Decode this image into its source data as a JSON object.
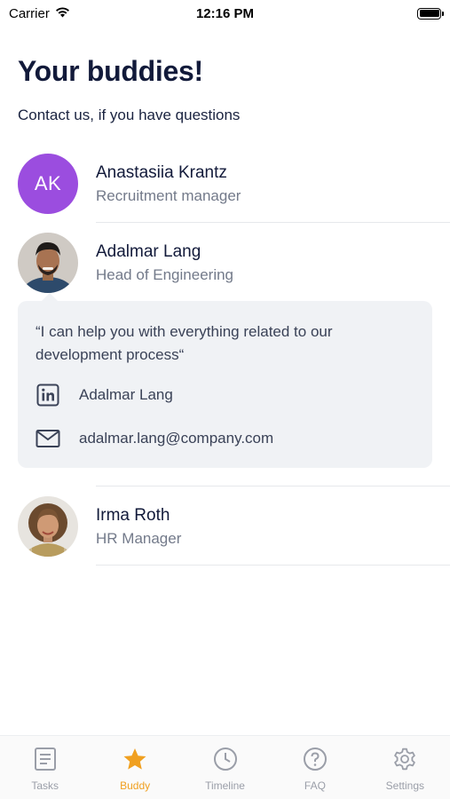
{
  "status_bar": {
    "carrier": "Carrier",
    "time": "12:16 PM"
  },
  "header": {
    "title": "Your buddies!",
    "subtitle": "Contact us, if you have questions"
  },
  "buddies": [
    {
      "initials": "AK",
      "name": "Anastasiia Krantz",
      "role": "Recruitment manager",
      "avatar_color": "#9b4ddf"
    },
    {
      "name": "Adalmar Lang",
      "role": "Head of Engineering",
      "expanded": true,
      "quote": "“I can help you with everything related to our development process“",
      "linkedin": "Adalmar Lang",
      "email": "adalmar.lang@company.com"
    },
    {
      "name": "Irma Roth",
      "role": "HR Manager"
    }
  ],
  "tabs": [
    {
      "label": "Tasks",
      "icon": "list-icon",
      "active": false
    },
    {
      "label": "Buddy",
      "icon": "star-icon",
      "active": true
    },
    {
      "label": "Timeline",
      "icon": "clock-icon",
      "active": false
    },
    {
      "label": "FAQ",
      "icon": "question-icon",
      "active": false
    },
    {
      "label": "Settings",
      "icon": "gear-icon",
      "active": false
    }
  ],
  "colors": {
    "accent": "#f0a020",
    "tab_inactive": "#9a9ea8",
    "card_background": "#f0f2f5"
  }
}
